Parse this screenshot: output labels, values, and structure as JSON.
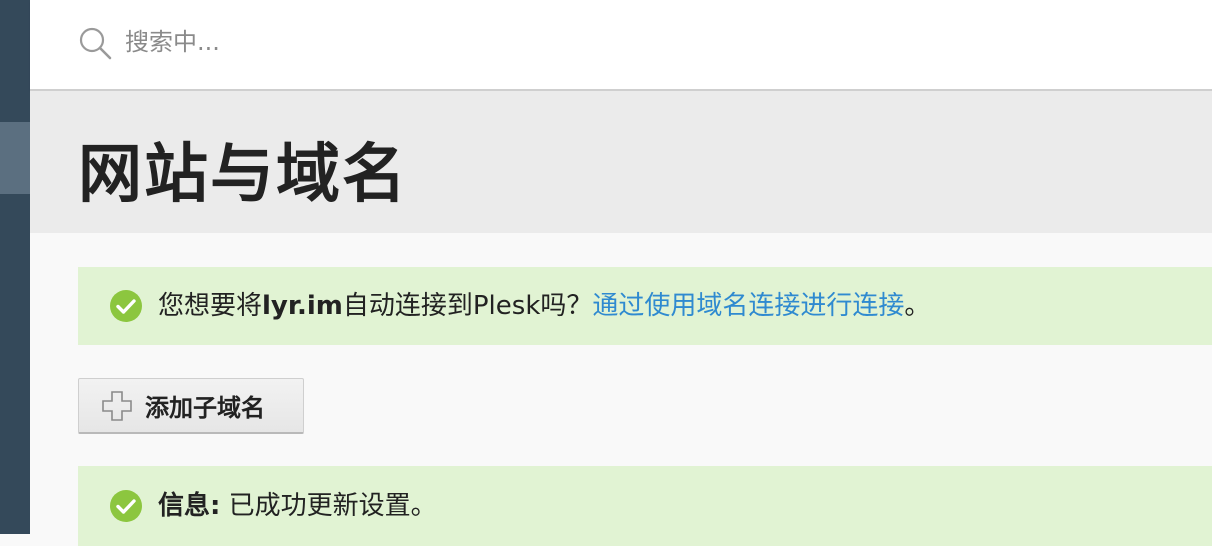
{
  "search": {
    "placeholder": "搜索中..."
  },
  "page": {
    "title": "网站与域名"
  },
  "alerts": [
    {
      "prefix": "您想要将",
      "domain": "lyr.im",
      "middle": "自动连接到Plesk吗？",
      "link": "通过使用域名连接进行连接",
      "suffix": "。"
    },
    {
      "label": "信息:",
      "message": " 已成功更新设置。"
    }
  ],
  "toolbar": {
    "add_subdomain_label": "添加子域名"
  },
  "icons": {
    "search": "search-icon",
    "check": "check-circle-icon",
    "plus": "plus-icon"
  },
  "colors": {
    "sidebar": "#34495a",
    "sidebar_active": "#5b6f80",
    "alert_bg": "#e1f3d3",
    "success": "#8cc63f",
    "link": "#2f8ad0"
  }
}
